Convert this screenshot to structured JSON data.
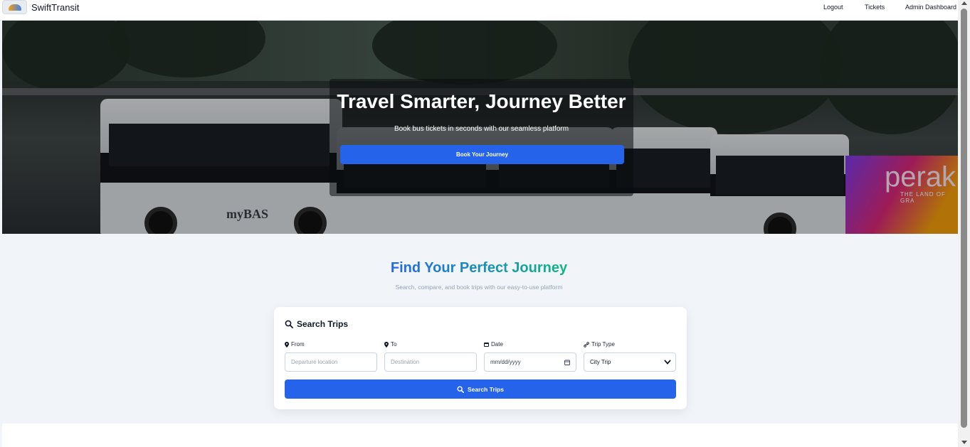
{
  "navbar": {
    "brand": "SwiftTransit",
    "links": [
      "Logout",
      "Tickets",
      "Admin Dashboard"
    ]
  },
  "hero": {
    "title": "Travel Smarter, Journey Better",
    "subtitle": "Book bus tickets in seconds with our seamless platform",
    "button": "Book Your Journey",
    "background_texts": [
      "myBAS",
      "perak",
      "THE LAND OF GRA"
    ]
  },
  "section": {
    "title": "Find Your Perfect Journey",
    "subtitle": "Search, compare, and book trips with our easy-to-use platform"
  },
  "search": {
    "title": "Search Trips",
    "from_label": "From",
    "from_placeholder": "Departure location",
    "to_label": "To",
    "to_placeholder": "Destination",
    "date_label": "Date",
    "date_value": "mm/dd/yyyy",
    "type_label": "Trip Type",
    "type_value": "City Trip",
    "button": "Search Trips"
  },
  "colors": {
    "primary": "#2563eb",
    "accent_gradient_end": "#10b981",
    "page_bg": "#f1f5f9"
  },
  "icons": [
    "search-icon",
    "map-pin-icon",
    "calendar-icon",
    "route-icon",
    "chevron-down-icon"
  ]
}
